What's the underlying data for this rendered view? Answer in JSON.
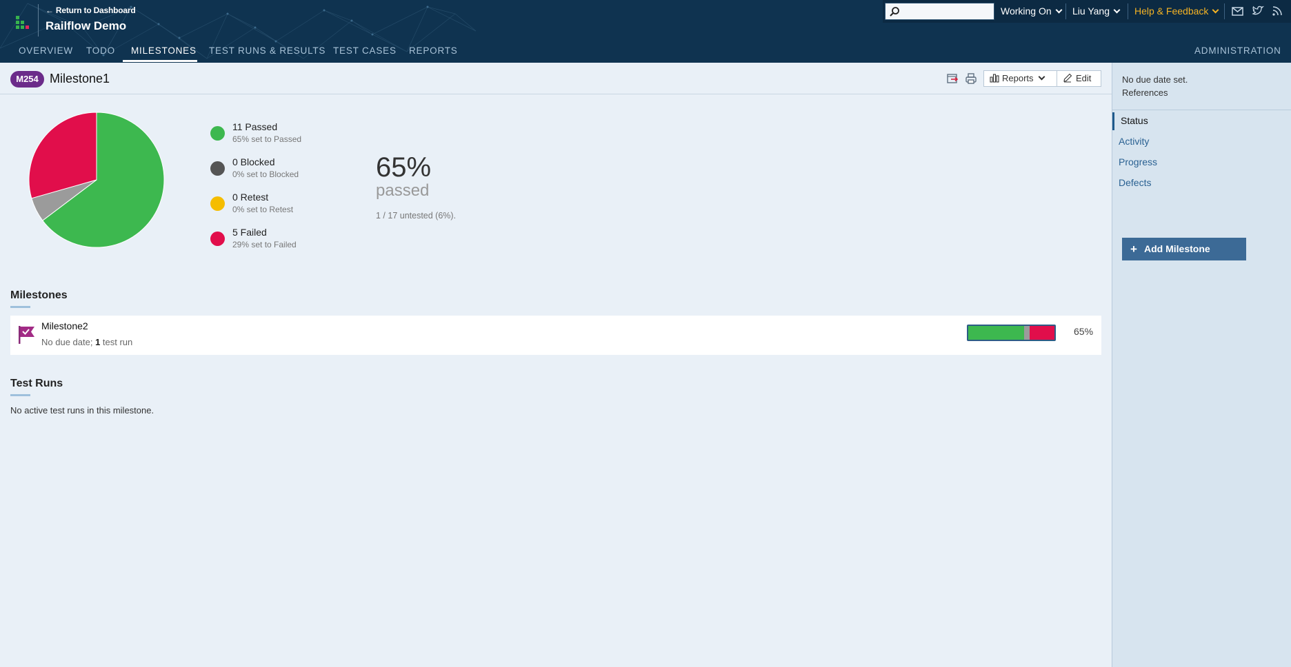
{
  "header": {
    "back_link": "← Return to Dashboard",
    "project_title": "Railflow Demo",
    "search": {
      "value": "",
      "placeholder": ""
    },
    "working_on": "Working On",
    "user": "Liu Yang",
    "help": "Help & Feedback",
    "icons": [
      "mail-icon",
      "twitter-icon",
      "rss-icon"
    ]
  },
  "nav": {
    "tabs": [
      {
        "label": "OVERVIEW",
        "active": false
      },
      {
        "label": "TODO",
        "active": false
      },
      {
        "label": "MILESTONES",
        "active": true
      },
      {
        "label": "TEST RUNS & RESULTS",
        "active": false
      },
      {
        "label": "TEST CASES",
        "active": false
      },
      {
        "label": "REPORTS",
        "active": false
      }
    ],
    "admin": "ADMINISTRATION"
  },
  "milestone": {
    "badge": "M254",
    "title": "Milestone1",
    "reports_label": "Reports",
    "edit_label": "Edit"
  },
  "stats": {
    "legend": [
      {
        "label": "11 Passed",
        "sub": "65% set to Passed",
        "color": "#3db84f"
      },
      {
        "label": "0 Blocked",
        "sub": "0% set to Blocked",
        "color": "#555555"
      },
      {
        "label": "0 Retest",
        "sub": "0% set to Retest",
        "color": "#f5bd00"
      },
      {
        "label": "5 Failed",
        "sub": "29% set to Failed",
        "color": "#e10e4b"
      }
    ],
    "percent": "65%",
    "percent_label": "passed",
    "untested": "1 / 17 untested (6%)."
  },
  "chart_data": {
    "type": "pie",
    "slices": [
      {
        "name": "Passed",
        "value": 11,
        "color": "#3db84f"
      },
      {
        "name": "Untested",
        "value": 1,
        "color": "#9b9b9b"
      },
      {
        "name": "Failed",
        "value": 5,
        "color": "#e10e4b"
      }
    ]
  },
  "milestones_section": {
    "title": "Milestones",
    "items": [
      {
        "name": "Milestone2",
        "meta_prefix": "No due date; ",
        "meta_count": "1",
        "meta_suffix": " test run",
        "progress": {
          "passed": 0.65,
          "untested": 0.06,
          "failed": 0.29
        },
        "percent": "65%"
      }
    ]
  },
  "test_runs_section": {
    "title": "Test Runs",
    "empty_text": "No active test runs in this milestone."
  },
  "sidebar": {
    "due_date": "No due date set.",
    "references": "References",
    "links": [
      {
        "label": "Status",
        "active": true
      },
      {
        "label": "Activity",
        "active": false
      },
      {
        "label": "Progress",
        "active": false
      },
      {
        "label": "Defects",
        "active": false
      }
    ],
    "add_button": "Add Milestone"
  }
}
